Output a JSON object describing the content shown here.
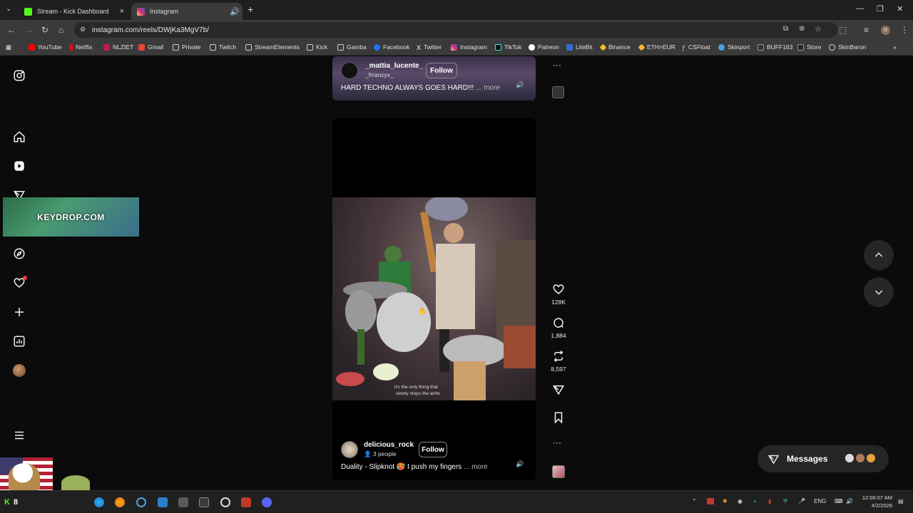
{
  "browser": {
    "tabs": [
      {
        "title": "Stream - Kick Dashboard",
        "close": "×"
      },
      {
        "title": "Instagram",
        "close": "×"
      }
    ],
    "new_tab": "+",
    "url": "instagram.com/reels/DWjKa3MgV7b/",
    "bookmarks": [
      "YouTube",
      "Netflix",
      "NLZIET",
      "Gmail",
      "Private",
      "Twitch",
      "StreamElements",
      "Kick",
      "Gamba",
      "Facebook",
      "Twitter",
      "Instagram",
      "TikTok",
      "Patreon",
      "LiteBit",
      "Binance",
      "ETH>EUR",
      "CSFloat",
      "Skinport",
      "BUFF163",
      "Store",
      "SkinBaron"
    ],
    "profile_initial": "D"
  },
  "overlay": {
    "banner": "KEYDROP.COM",
    "badge_number": "8"
  },
  "reels": [
    {
      "username": "_mattia_lucente_",
      "sub": "_frrancyx_",
      "follow": "Follow",
      "caption": "HARD TECHNO ALWAYS GOES HARD!!!",
      "more": "... more"
    },
    {
      "username": "delicious_rock",
      "sub": "3 people",
      "follow": "Follow",
      "caption": "Duality - Slipknot 🥵 I push my fingers",
      "more": "... more",
      "subtitle_line1": "it's the only thing that",
      "subtitle_line2": "slowly stops the ache",
      "likes": "128K",
      "comments": "1,884",
      "reposts": "8,597"
    }
  ],
  "messages": {
    "label": "Messages"
  },
  "taskbar": {
    "lang": "ENG",
    "time": "12:06:07 AM",
    "date": "4/2/2026"
  },
  "colors": {
    "accent_red": "#ff3040",
    "kick_green": "#53fc18",
    "background": "#0b0b0b"
  }
}
